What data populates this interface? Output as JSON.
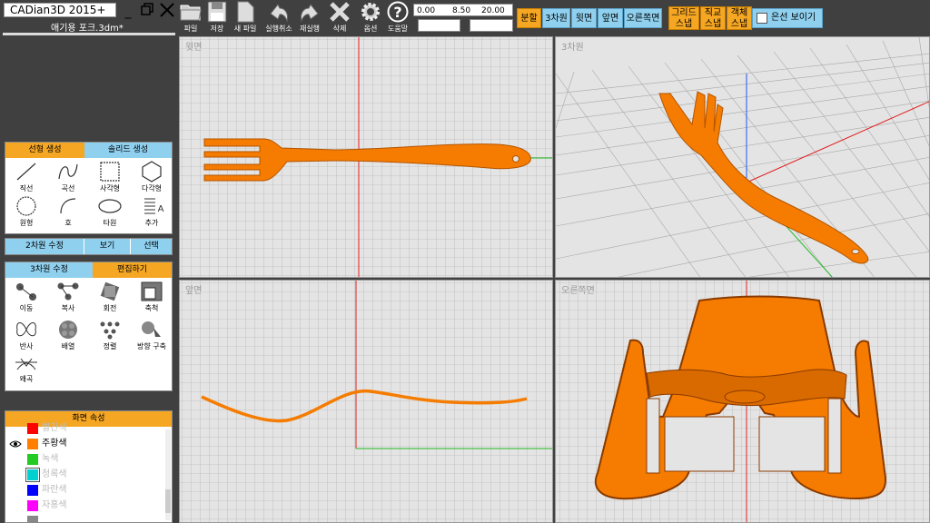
{
  "app": {
    "title": "CADian3D 2015+",
    "file_name": "애기용 포크.3dm*"
  },
  "toolbar": {
    "tools": [
      {
        "label": "파일",
        "icon": "folder-icon"
      },
      {
        "label": "저장",
        "icon": "save-icon"
      },
      {
        "label": "새 파일",
        "icon": "new-file-icon"
      },
      {
        "label": "실행취소",
        "icon": "undo-icon"
      },
      {
        "label": "재실행",
        "icon": "redo-icon"
      },
      {
        "label": "삭제",
        "icon": "delete-icon"
      },
      {
        "label": "옵션",
        "icon": "gear-icon"
      },
      {
        "label": "도움말",
        "icon": "help-icon"
      }
    ],
    "coords": [
      "0.00",
      "8.50",
      "20.00"
    ],
    "view_buttons": [
      "분할",
      "3차원",
      "윗면",
      "앞면",
      "오른쪽면"
    ],
    "snap_buttons": [
      {
        "line1": "그리드",
        "line2": "스냅"
      },
      {
        "line1": "직교",
        "line2": "스냅"
      },
      {
        "line1": "객체",
        "line2": "스냅"
      }
    ],
    "hidden_line_label": "은선 보이기"
  },
  "panels": {
    "create": {
      "tabs": [
        "선형 생성",
        "솔리드 생성"
      ],
      "tools": [
        "직선",
        "곡선",
        "사각형",
        "다각형",
        "원형",
        "호",
        "타원",
        "추가"
      ]
    },
    "edit2d": {
      "tabs": [
        "2차원 수정",
        "보기",
        "선택"
      ]
    },
    "edit3d": {
      "tabs": [
        "3차원 수정",
        "편집하기"
      ],
      "tools": [
        "이동",
        "복사",
        "회전",
        "축척",
        "반사",
        "배열",
        "정렬",
        "방향 구축",
        "왜곡"
      ]
    },
    "layers": {
      "title": "화면 속성",
      "items": [
        {
          "name": "빨간색",
          "color": "#ff0000"
        },
        {
          "name": "주황색",
          "color": "#ff7f00"
        },
        {
          "name": "녹색",
          "color": "#22cc22"
        },
        {
          "name": "청록색",
          "color": "#00d0d0"
        },
        {
          "name": "파란색",
          "color": "#0000ff"
        },
        {
          "name": "자홍색",
          "color": "#ff00ff"
        },
        {
          "name": "",
          "color": "#888888"
        }
      ]
    }
  },
  "viewports": {
    "top": "윗면",
    "perspective": "3차원",
    "front": "앞면",
    "right": "오른쪽면"
  },
  "colors": {
    "accent_orange": "#f5a623",
    "accent_blue": "#8fd0ef",
    "model_orange": "#f57c00"
  }
}
